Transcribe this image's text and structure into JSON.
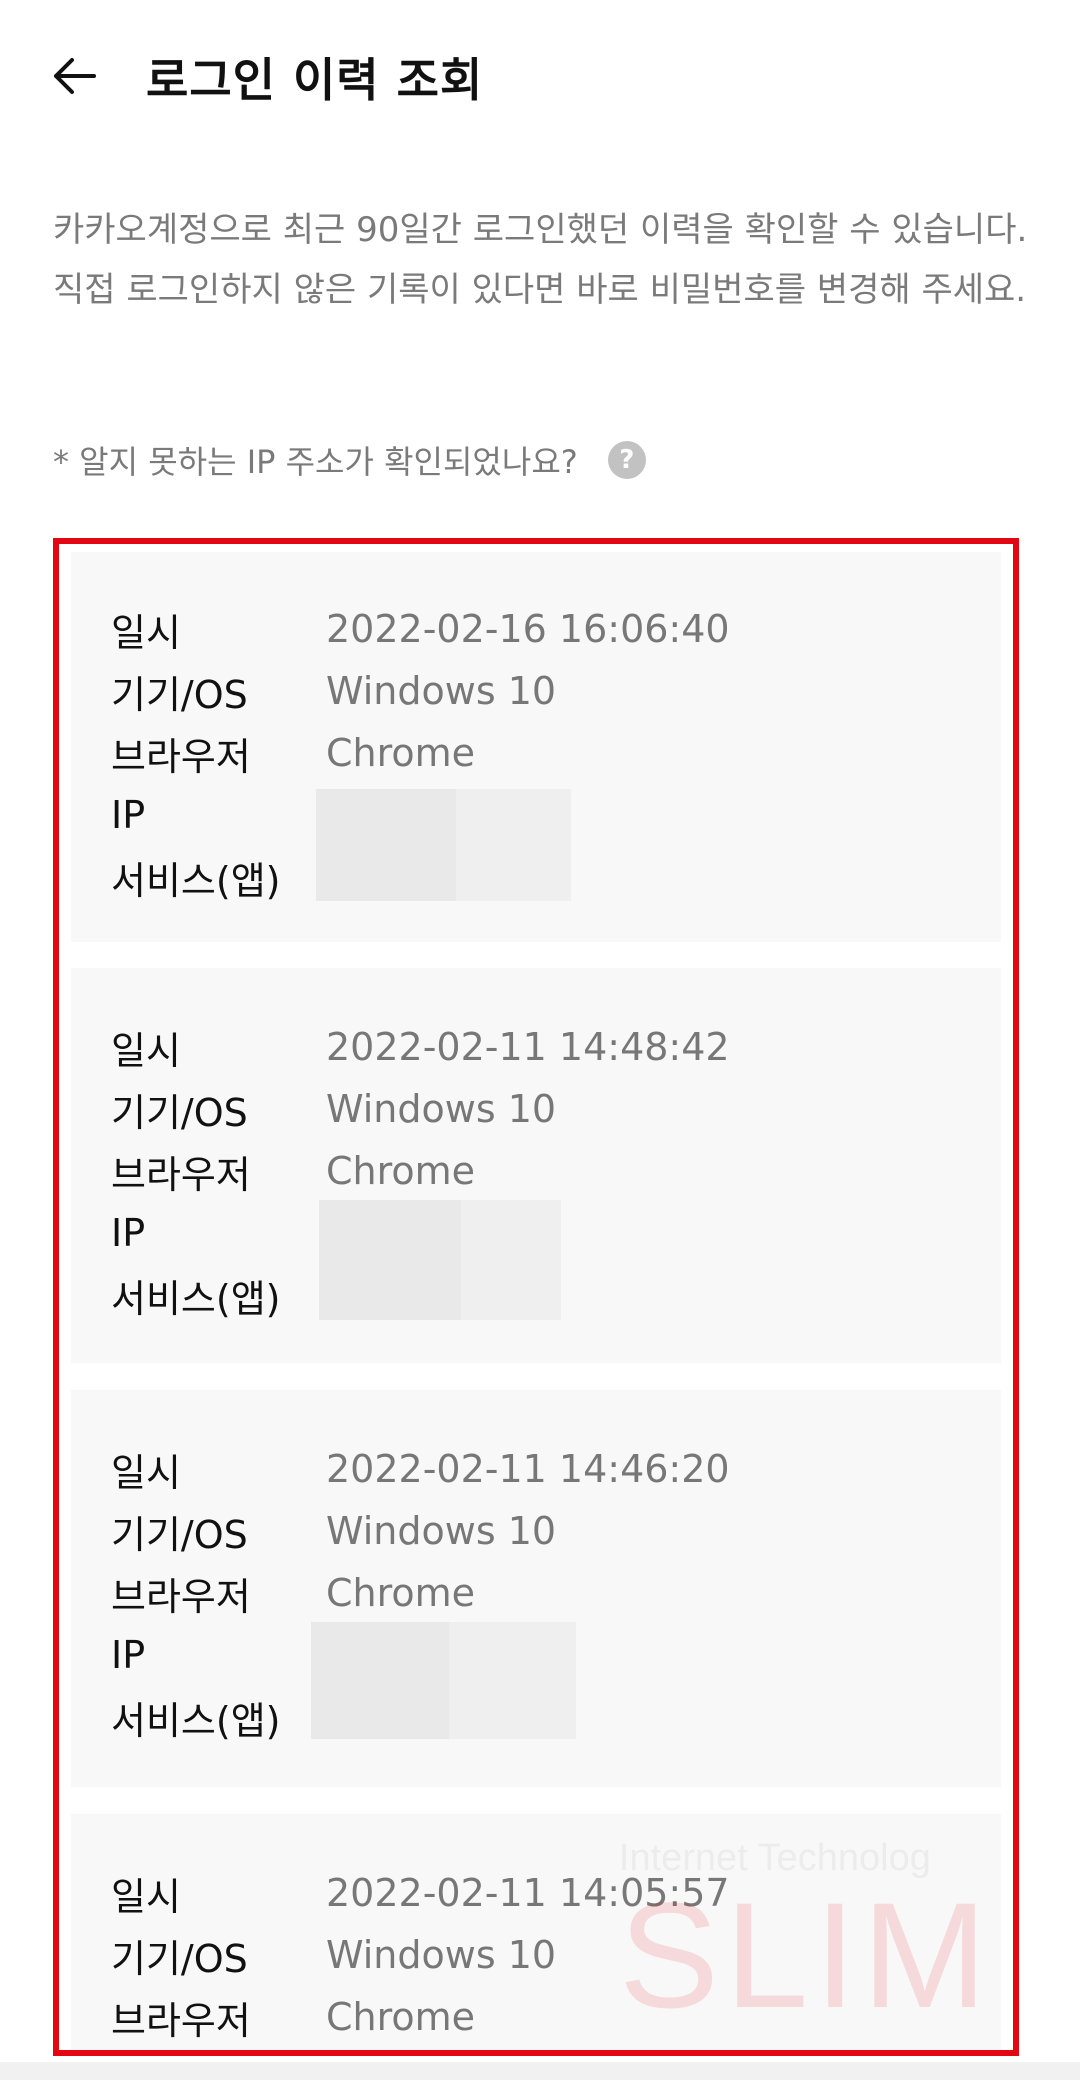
{
  "header": {
    "title": "로그인 이력 조회",
    "back_icon": "arrow-left-icon"
  },
  "description": "카카오계정으로 최근 90일간 로그인했던 이력을 확인할 수 있습니다. 직접 로그인하지 않은 기록이 있다면 바로 비밀번호를 변경해 주세요.",
  "ip_question": {
    "text": "* 알지 못하는 IP 주소가 확인되었나요?",
    "icon": "question-icon",
    "icon_glyph": "?"
  },
  "labels": {
    "datetime": "일시",
    "device_os": "기기/OS",
    "browser": "브라우저",
    "ip": "IP",
    "service": "서비스(앱)"
  },
  "records": [
    {
      "datetime": "2022-02-16 16:06:40",
      "device_os": "Windows 10",
      "browser": "Chrome"
    },
    {
      "datetime": "2022-02-11 14:48:42",
      "device_os": "Windows 10",
      "browser": "Chrome"
    },
    {
      "datetime": "2022-02-11 14:46:20",
      "device_os": "Windows 10",
      "browser": "Chrome"
    },
    {
      "datetime": "2022-02-11 14:05:57",
      "device_os": "Windows 10",
      "browser": "Chrome"
    }
  ],
  "watermark": {
    "top": "Internet Technolog",
    "main": "SLIM"
  },
  "colors": {
    "highlight_border": "#e30613",
    "record_bg": "#f8f8f8",
    "value_text": "#777777"
  }
}
